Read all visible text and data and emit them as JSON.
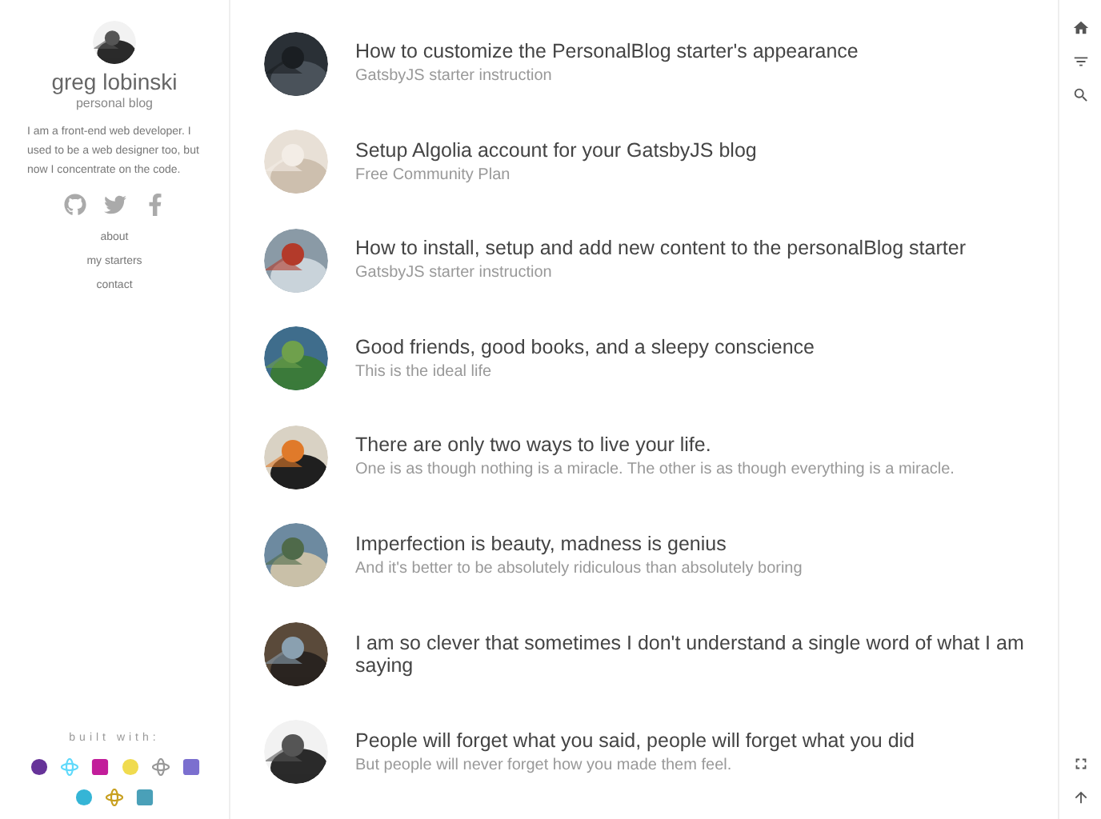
{
  "sidebar": {
    "name": "greg lobinski",
    "tagline": "personal blog",
    "bio": "I am a front-end web developer. I used to be a web designer too, but now I concentrate on the code.",
    "links": [
      "about",
      "my starters",
      "contact"
    ],
    "built_with": "built with:"
  },
  "posts": [
    {
      "title": "How to customize the PersonalBlog starter's appearance",
      "subtitle": "GatsbyJS starter instruction"
    },
    {
      "title": "Setup Algolia account for your GatsbyJS blog",
      "subtitle": "Free Community Plan"
    },
    {
      "title": "How to install, setup and add new content to the personalBlog starter",
      "subtitle": "GatsbyJS starter instruction"
    },
    {
      "title": "Good friends, good books, and a sleepy conscience",
      "subtitle": "This is the ideal life"
    },
    {
      "title": "There are only two ways to live your life.",
      "subtitle": "One is as though nothing is a miracle. The other is as though everything is a miracle."
    },
    {
      "title": "Imperfection is beauty, madness is genius",
      "subtitle": "And it's better to be absolutely ridiculous than absolutely boring"
    },
    {
      "title": "I am so clever that sometimes I don't understand a single word of what I am saying"
    },
    {
      "title": "People will forget what you said, people will forget what you did",
      "subtitle": "But people will never forget how you made them feel."
    }
  ]
}
